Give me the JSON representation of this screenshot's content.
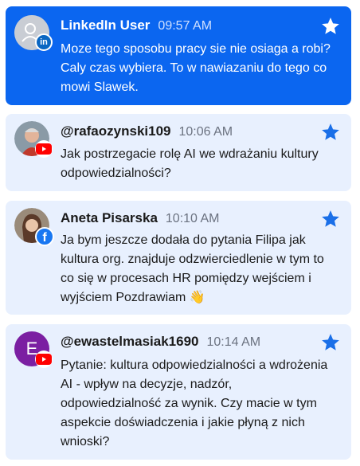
{
  "comments": [
    {
      "author": "LinkedIn User",
      "time": "09:57 AM",
      "text": "Moze tego sposobu pracy sie nie osiaga a robi? Caly czas wybiera. To w nawiazaniu do tego co mowi Slawek.",
      "source": "linkedin"
    },
    {
      "author": "@rafaozynski109",
      "time": "10:06 AM",
      "text": "Jak postrzegacie rolę AI we wdrażaniu kultury odpowiedzialności?",
      "source": "youtube"
    },
    {
      "author": "Aneta Pisarska",
      "time": "10:10 AM",
      "text": "Ja bym jeszcze dodała do pytania Filipa jak kultura org. znajduje odzwierciedlenie w tym to co się w procesach HR pomiędzy wejściem i wyjściem Pozdrawiam 👋",
      "source": "facebook"
    },
    {
      "author": "@ewastelmasiak1690",
      "time": "10:14 AM",
      "avatar_letter": "E",
      "text": "Pytanie: kultura odpowiedzialności a wdrożenia AI - wpływ na decyzje, nadzór, odpowiedzialność za wynik. Czy macie w tym aspekcie doświadczenia i jakie płyną z nich wnioski?",
      "source": "youtube"
    }
  ],
  "colors": {
    "highlight": "#0b66f0",
    "card": "#e8f0fe",
    "star_highlight": "#ffffff",
    "star": "#1a6fe8",
    "youtube": "#ff0000",
    "facebook": "#1877f2",
    "linkedin": "#0a66c2",
    "avatar_letter_bg": "#7b1fa2"
  }
}
